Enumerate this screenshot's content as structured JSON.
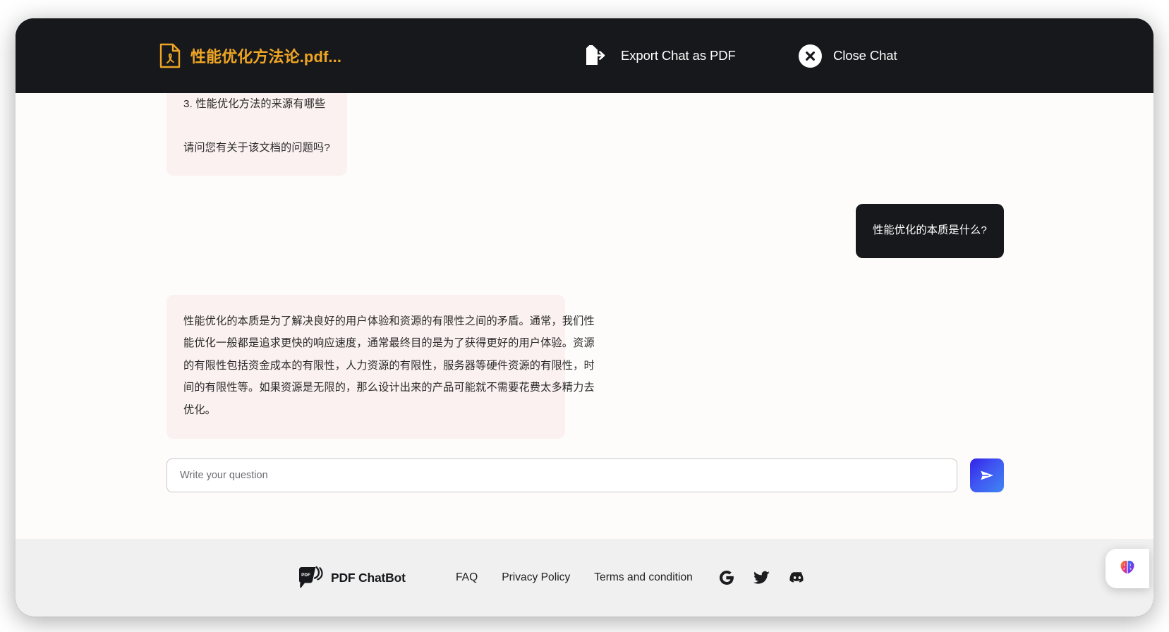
{
  "header": {
    "document_name": "性能优化方法论.pdf...",
    "document_icon": "pdf-file-icon",
    "export_label": "Export Chat as PDF",
    "export_icon": "export-document-icon",
    "close_label": "Close Chat",
    "close_icon": "close-x-icon",
    "accent_color": "#efa524",
    "background_color": "#17181c"
  },
  "chat": {
    "messages": [
      {
        "role": "bot",
        "clipped": true,
        "lines": [
          "3. 性能优化方法的来源有哪些"
        ],
        "paragraph": "请问您有关于该文档的问题吗?"
      },
      {
        "role": "user",
        "text": "性能优化的本质是什么?"
      },
      {
        "role": "bot",
        "lines": [
          "性能优化的本质是为了解决良好的用户体验和资源的有限性之间的矛盾。通常，我们性",
          "能优化一般都是追求更快的响应速度，通常最终目的是为了获得更好的用户体验。资源",
          "的有限性包括资金成本的有限性，人力资源的有限性，服务器等硬件资源的有限性，时",
          "间的有限性等。如果资源是无限的，那么设计出来的产品可能就不需要花费太多精力去",
          "优化。"
        ]
      }
    ],
    "bot_bubble_color": "#fbf1f0",
    "user_bubble_color": "#17181c",
    "background_color": "#fdfcfa"
  },
  "composer": {
    "placeholder": "Write your question",
    "value": "",
    "send_icon": "send-paper-plane-icon",
    "send_button_color": "#3f56f2"
  },
  "footer": {
    "brand_name": "PDF ChatBot",
    "brand_logo_text": "PDF",
    "brand_icon": "pdf-chatbot-logo",
    "links": [
      {
        "label": "FAQ"
      },
      {
        "label": "Privacy Policy"
      },
      {
        "label": "Terms and condition"
      }
    ],
    "social": [
      {
        "name": "google-icon"
      },
      {
        "name": "twitter-icon"
      },
      {
        "name": "discord-icon"
      }
    ],
    "background_color": "#f0f0f0"
  },
  "floating_widget": {
    "icon": "brain-icon"
  }
}
